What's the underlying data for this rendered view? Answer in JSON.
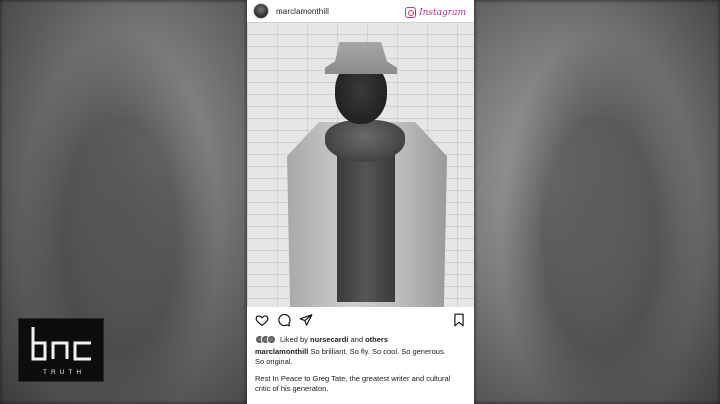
{
  "post": {
    "username": "marclamonthill",
    "platform_label": "Instagram",
    "liked_by": {
      "prefix": "Liked by",
      "user": "nursecardi",
      "conjunction": "and",
      "suffix": "others"
    },
    "caption": {
      "author": "marclamonthill",
      "text_line1": "So brilliant. So fly. So cool. So generous.",
      "text_line2": "So original.",
      "text_line3": "Rest In Peace to Greg Tate, the greatest writer and cultural",
      "text_line4": "critic of his generaton."
    }
  },
  "logo": {
    "mark": "bnc",
    "tagline": "TRUTH"
  },
  "colors": {
    "instagram_accent": "#b1338e",
    "background": "#1c1c1c",
    "card": "#ffffff"
  }
}
